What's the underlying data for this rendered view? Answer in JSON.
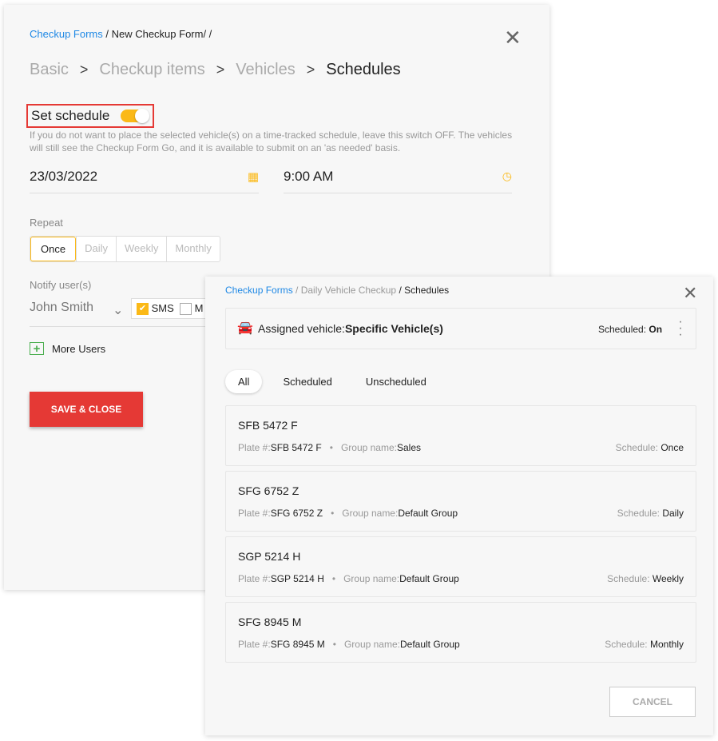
{
  "back": {
    "breadcrumb": {
      "link": "Checkup Forms",
      "rest": " / New Checkup Form/ /"
    },
    "steps": [
      "Basic",
      "Checkup items",
      "Vehicles",
      "Schedules"
    ],
    "set_schedule_label": "Set schedule",
    "set_schedule_on": true,
    "hint": "If you do not want to place the selected vehicle(s) on a time-tracked schedule, leave this switch OFF. The vehicles will still see the Checkup Form Go, and it is available to submit on an 'as needed' basis.",
    "date": "23/03/2022",
    "time": "9:00 AM",
    "repeat_label": "Repeat",
    "repeat_options": [
      "Once",
      "Daily",
      "Weekly",
      "Monthly"
    ],
    "repeat_selected": "Once",
    "notify_label": "Notify user(s)",
    "notify_user": "John Smith",
    "sms_label": "SMS",
    "mail_label": "M",
    "more_users": "More Users",
    "save": "SAVE & CLOSE"
  },
  "front": {
    "breadcrumb": {
      "link": "Checkup Forms",
      "mid": " / Daily Vehicle Checkup",
      "last": " / Schedules"
    },
    "assigned_label": "Assigned vehicle:",
    "assigned_value": "Specific Vehicle(s)",
    "scheduled_label": "Scheduled: ",
    "scheduled_value": "On",
    "tabs": [
      "All",
      "Scheduled",
      "Unscheduled"
    ],
    "plate_label": "Plate #:",
    "group_label": "Group name:",
    "schedule_label": "Schedule: ",
    "vehicles": [
      {
        "name": "SFB 5472 F",
        "plate": "SFB 5472 F",
        "group": "Sales",
        "schedule": "Once"
      },
      {
        "name": "SFG 6752 Z",
        "plate": "SFG 6752 Z",
        "group": "Default Group",
        "schedule": "Daily"
      },
      {
        "name": "SGP 5214 H",
        "plate": "SGP 5214 H",
        "group": "Default Group",
        "schedule": "Weekly"
      },
      {
        "name": "SFG 8945 M",
        "plate": "SFG 8945 M",
        "group": "Default Group",
        "schedule": "Monthly"
      }
    ],
    "cancel": "CANCEL"
  },
  "colors": {
    "accent": "#fbb917",
    "danger": "#e53935",
    "link": "#1e88e5"
  }
}
